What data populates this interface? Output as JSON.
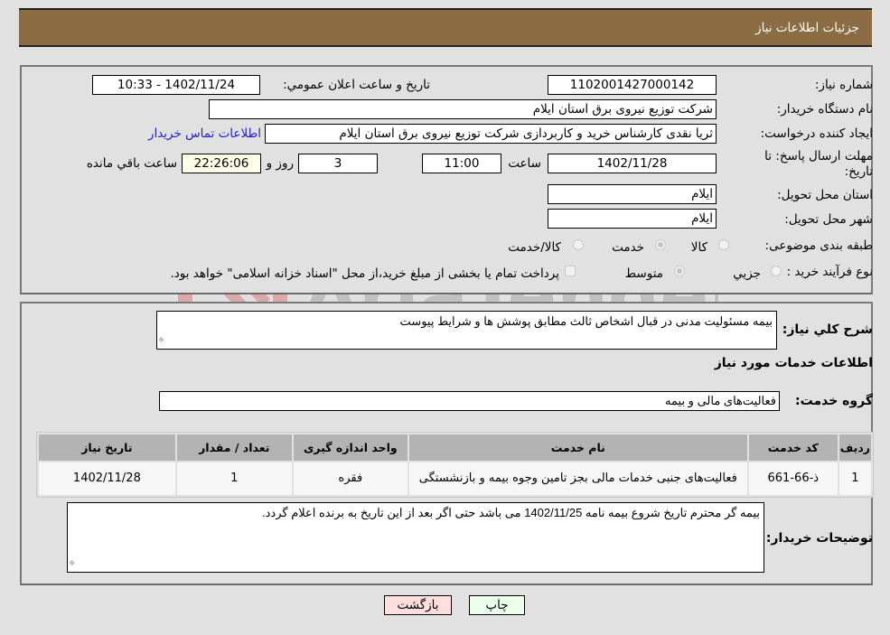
{
  "header": {
    "title": "جزئیات اطلاعات نیاز"
  },
  "details": {
    "need_number_label": "شماره نیاز:",
    "need_number": "1102001427000142",
    "announce_label": "تاریخ و ساعت اعلان عمومي:",
    "announce_value": "1402/11/24 - 10:33",
    "buyer_org_label": "نام دستگاه خریدار:",
    "buyer_org": "شرکت توزیع نیروی برق استان ایلام",
    "creator_label": "ایجاد کننده درخواست:",
    "creator": "ثریا نقدی کارشناس خرید و کاربردازی شرکت توزیع نیروی برق استان ایلام",
    "contact_link": "اطلاعات تماس خریدار",
    "deadline_label_line1": "مهلت ارسال پاسخ: تا",
    "deadline_label_line2": "تاریخ:",
    "deadline_date": "1402/11/28",
    "time_label": "ساعت",
    "deadline_time": "11:00",
    "days_value": "3",
    "days_label": "روز و",
    "remaining_time": "22:26:06",
    "remaining_label": "ساعت باقي مانده",
    "province_label": "استان محل تحویل:",
    "province": "ایلام",
    "city_label": "شهر محل تحویل:",
    "city": "ایلام",
    "category_label": "طبقه بندی موضوعی:",
    "category_options": [
      {
        "label": "کالا",
        "selected": false
      },
      {
        "label": "خدمت",
        "selected": true
      },
      {
        "label": "کالا/خدمت",
        "selected": false
      }
    ],
    "process_label": "نوع فرآیند خرید :",
    "process_options": [
      {
        "label": "جزیي",
        "selected": false
      },
      {
        "label": "متوسط",
        "selected": true
      }
    ],
    "treasury_checkbox_label": "پرداخت تمام یا بخشی از مبلغ خرید،از محل \"اسناد خزانه اسلامی\" خواهد بود.",
    "treasury_checked": false
  },
  "description": {
    "label": "شرح کلي نیاز:",
    "value": "بیمه مسئولیت مدنی در قبال اشخاص ثالث مطابق پوشش ها و شرایط پیوست"
  },
  "services": {
    "section_title": "اطلاعات خدمات مورد نیاز",
    "group_label": "گروه خدمت:",
    "group_value": "فعالیت‌های مالی و بیمه",
    "columns": [
      "ردیف",
      "کد خدمت",
      "نام خدمت",
      "واحد اندازه گیری",
      "تعداد / مقدار",
      "تاریخ نیاز"
    ],
    "rows": [
      {
        "row": "1",
        "code": "ذ-66-661",
        "name": "فعالیت‌های جنبی خدمات مالی بجز تامین وجوه بیمه و بازنشستگی",
        "unit": "فقره",
        "quantity": "1",
        "date": "1402/11/28"
      }
    ]
  },
  "buyer_notes": {
    "label": "توضیحات خریدار:",
    "value": "بیمه گر محترم تاریخ شروع بیمه نامه 1402/11/25 می باشد حتی اگر بعد از این تاریخ به برنده اعلام گردد."
  },
  "buttons": {
    "print": "چاپ",
    "back": "بازگشت"
  },
  "watermark": {
    "text": "AriaTender.neT"
  },
  "colors": {
    "header_bg": "#8b6c43",
    "print_bg": "#ebffeb",
    "back_bg": "#ffdede",
    "link": "#2222cc",
    "remaining_bg": "#ffffe7"
  }
}
